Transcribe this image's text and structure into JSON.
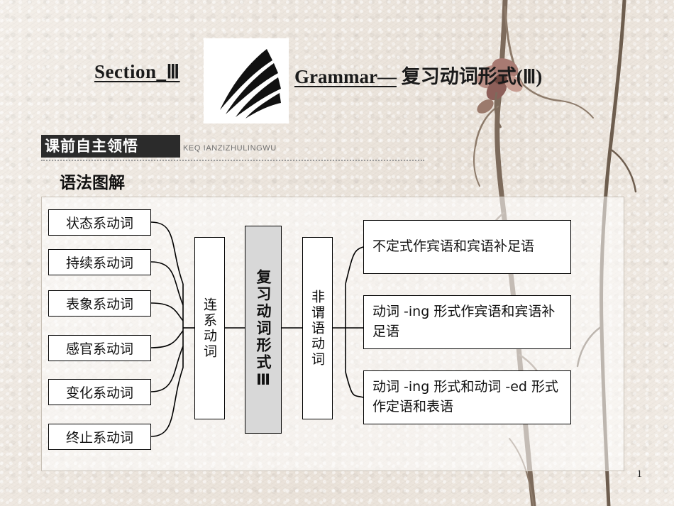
{
  "page": {
    "number": "1"
  },
  "header": {
    "section_label": "Section_Ⅲ",
    "grammar_label_underlined": "Grammar—",
    "grammar_label_rest": " 复习动词形式(Ⅲ)",
    "logo_name": "swoosh-logo"
  },
  "banner": {
    "title": "课前自主领悟",
    "pinyin": "KEQ IANZIZHULINGWU"
  },
  "subheading": "语法图解",
  "chart_data": {
    "type": "diagram",
    "title": "语法图解",
    "center": "复习动词形式Ⅲ",
    "branches": [
      {
        "name": "连系动词",
        "children": [
          "状态系动词",
          "持续系动词",
          "表象系动词",
          "感官系动词",
          "变化系动词",
          "终止系动词"
        ]
      },
      {
        "name": "非谓语动词",
        "children": [
          "不定式作宾语和宾语补足语",
          "动词 -ing 形式作宾语和宾语补足语",
          "动词 -ing 形式和动词 -ed 形式作定语和表语"
        ]
      }
    ]
  },
  "diagram": {
    "left_nodes": [
      "状态系动词",
      "持续系动词",
      "表象系动词",
      "感官系动词",
      "变化系动词",
      "终止系动词"
    ],
    "linking_verb": "连系动词",
    "center_node": "复习动词形式Ⅲ",
    "nonfinite_verb": "非谓语动词",
    "right_nodes": [
      "不定式作宾语和宾语补足语",
      "动词 -ing 形式作宾语和宾语补足语",
      "动词 -ing 形式和动词 -ed 形式作定语和表语"
    ]
  }
}
